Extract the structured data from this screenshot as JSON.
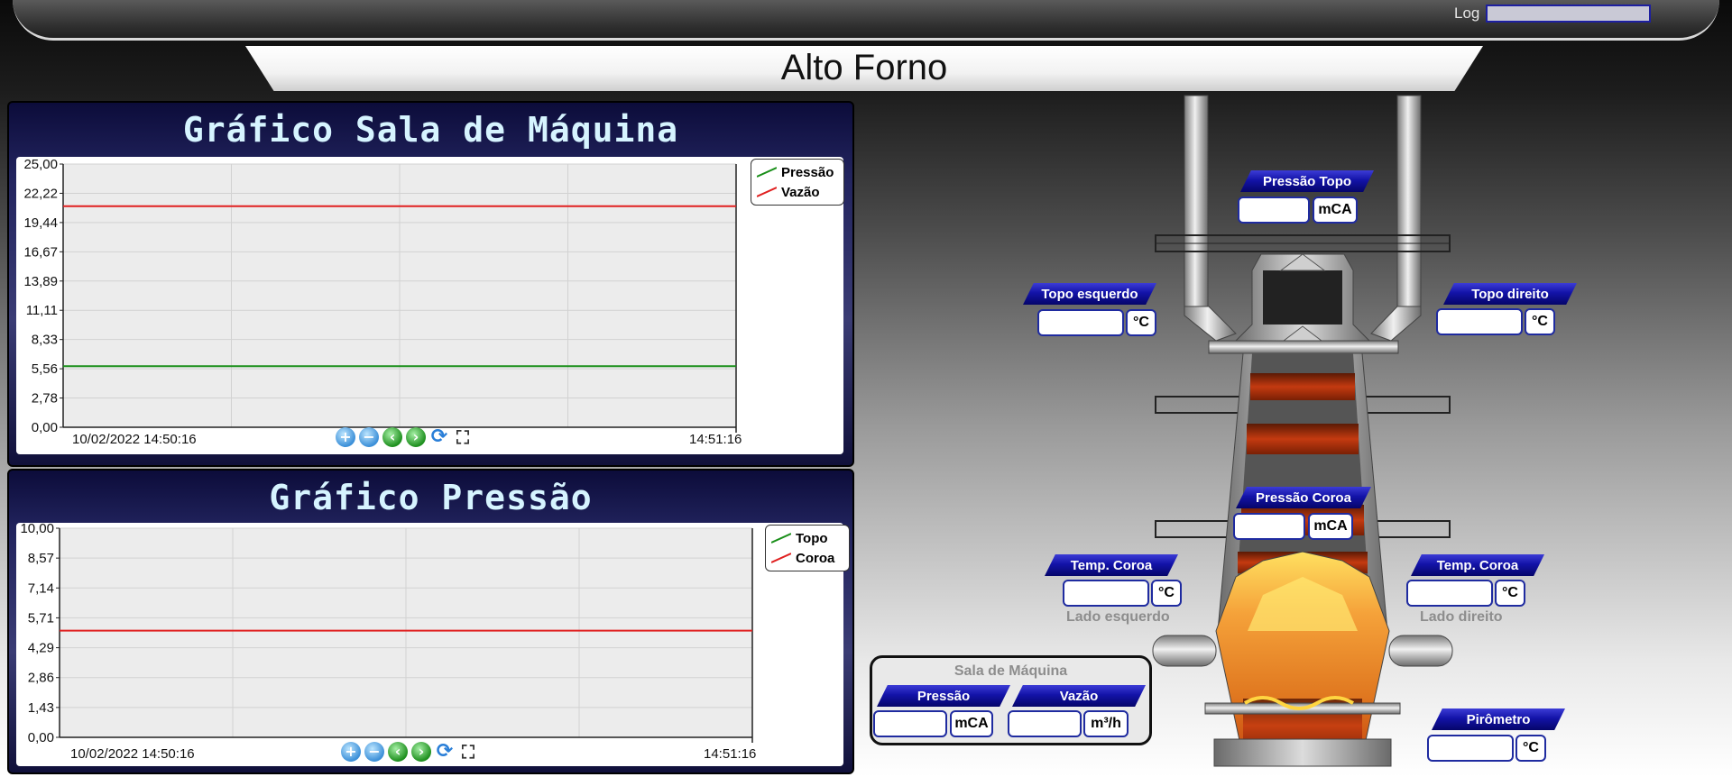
{
  "header": {
    "log_label": "Log",
    "log_value": ""
  },
  "page_title": "Alto Forno",
  "chart_machine": {
    "title": "Gráfico Sala de Máquina",
    "legend": [
      {
        "name": "Pressão",
        "color": "#1a8f1a"
      },
      {
        "name": "Vazão",
        "color": "#e02020"
      }
    ],
    "start_time": "10/02/2022 14:50:16",
    "end_time": "14:51:16",
    "y_ticks": [
      "25,00",
      "22,22",
      "19,44",
      "16,67",
      "13,89",
      "11,11",
      "8,33",
      "5,56",
      "2,78",
      "0,00"
    ]
  },
  "chart_pressure": {
    "title": "Gráfico Pressão",
    "legend": [
      {
        "name": "Topo",
        "color": "#1a8f1a"
      },
      {
        "name": "Coroa",
        "color": "#e02020"
      }
    ],
    "start_time": "10/02/2022 14:50:16",
    "end_time": "14:51:16",
    "y_ticks": [
      "10,00",
      "8,57",
      "7,14",
      "5,71",
      "4,29",
      "2,86",
      "1,43",
      "0,00"
    ]
  },
  "chart_data": [
    {
      "type": "line",
      "title": "Gráfico Sala de Máquina",
      "x": [
        "10/02/2022 14:50:16",
        "14:51:16"
      ],
      "ylim": [
        0,
        25
      ],
      "grid": true,
      "legend_position": "top-right",
      "series": [
        {
          "name": "Pressão",
          "color": "#1a8f1a",
          "values": [
            5.8,
            5.8
          ]
        },
        {
          "name": "Vazão",
          "color": "#e02020",
          "values": [
            21.0,
            21.0
          ]
        }
      ]
    },
    {
      "type": "line",
      "title": "Gráfico Pressão",
      "x": [
        "10/02/2022 14:50:16",
        "14:51:16"
      ],
      "ylim": [
        0,
        10
      ],
      "grid": true,
      "legend_position": "top-right",
      "series": [
        {
          "name": "Topo",
          "color": "#1a8f1a",
          "values": []
        },
        {
          "name": "Coroa",
          "color": "#e02020",
          "values": [
            5.1,
            5.1
          ]
        }
      ]
    }
  ],
  "toolbar_icons": [
    "zoom-in-icon",
    "zoom-out-icon",
    "scroll-left-icon",
    "scroll-right-icon",
    "refresh-icon",
    "fullscreen-icon"
  ],
  "furnace": {
    "pressao_topo": {
      "label": "Pressão Topo",
      "value": "",
      "unit": "mCA"
    },
    "topo_esquerdo": {
      "label": "Topo esquerdo",
      "value": "",
      "unit": "°C"
    },
    "topo_direito": {
      "label": "Topo direito",
      "value": "",
      "unit": "°C"
    },
    "pressao_coroa": {
      "label": "Pressão Coroa",
      "value": "",
      "unit": "mCA"
    },
    "temp_coroa_esq": {
      "label": "Temp. Coroa",
      "value": "",
      "unit": "°C",
      "side": "Lado esquerdo"
    },
    "temp_coroa_dir": {
      "label": "Temp. Coroa",
      "value": "",
      "unit": "°C",
      "side": "Lado direito"
    },
    "pirometro": {
      "label": "Pirômetro",
      "value": "",
      "unit": "°C"
    }
  },
  "machine_room": {
    "title": "Sala de Máquina",
    "pressao": {
      "label": "Pressão",
      "value": "",
      "unit": "mCA"
    },
    "vazao": {
      "label": "Vazão",
      "value": "",
      "unit": "m³/h"
    }
  }
}
